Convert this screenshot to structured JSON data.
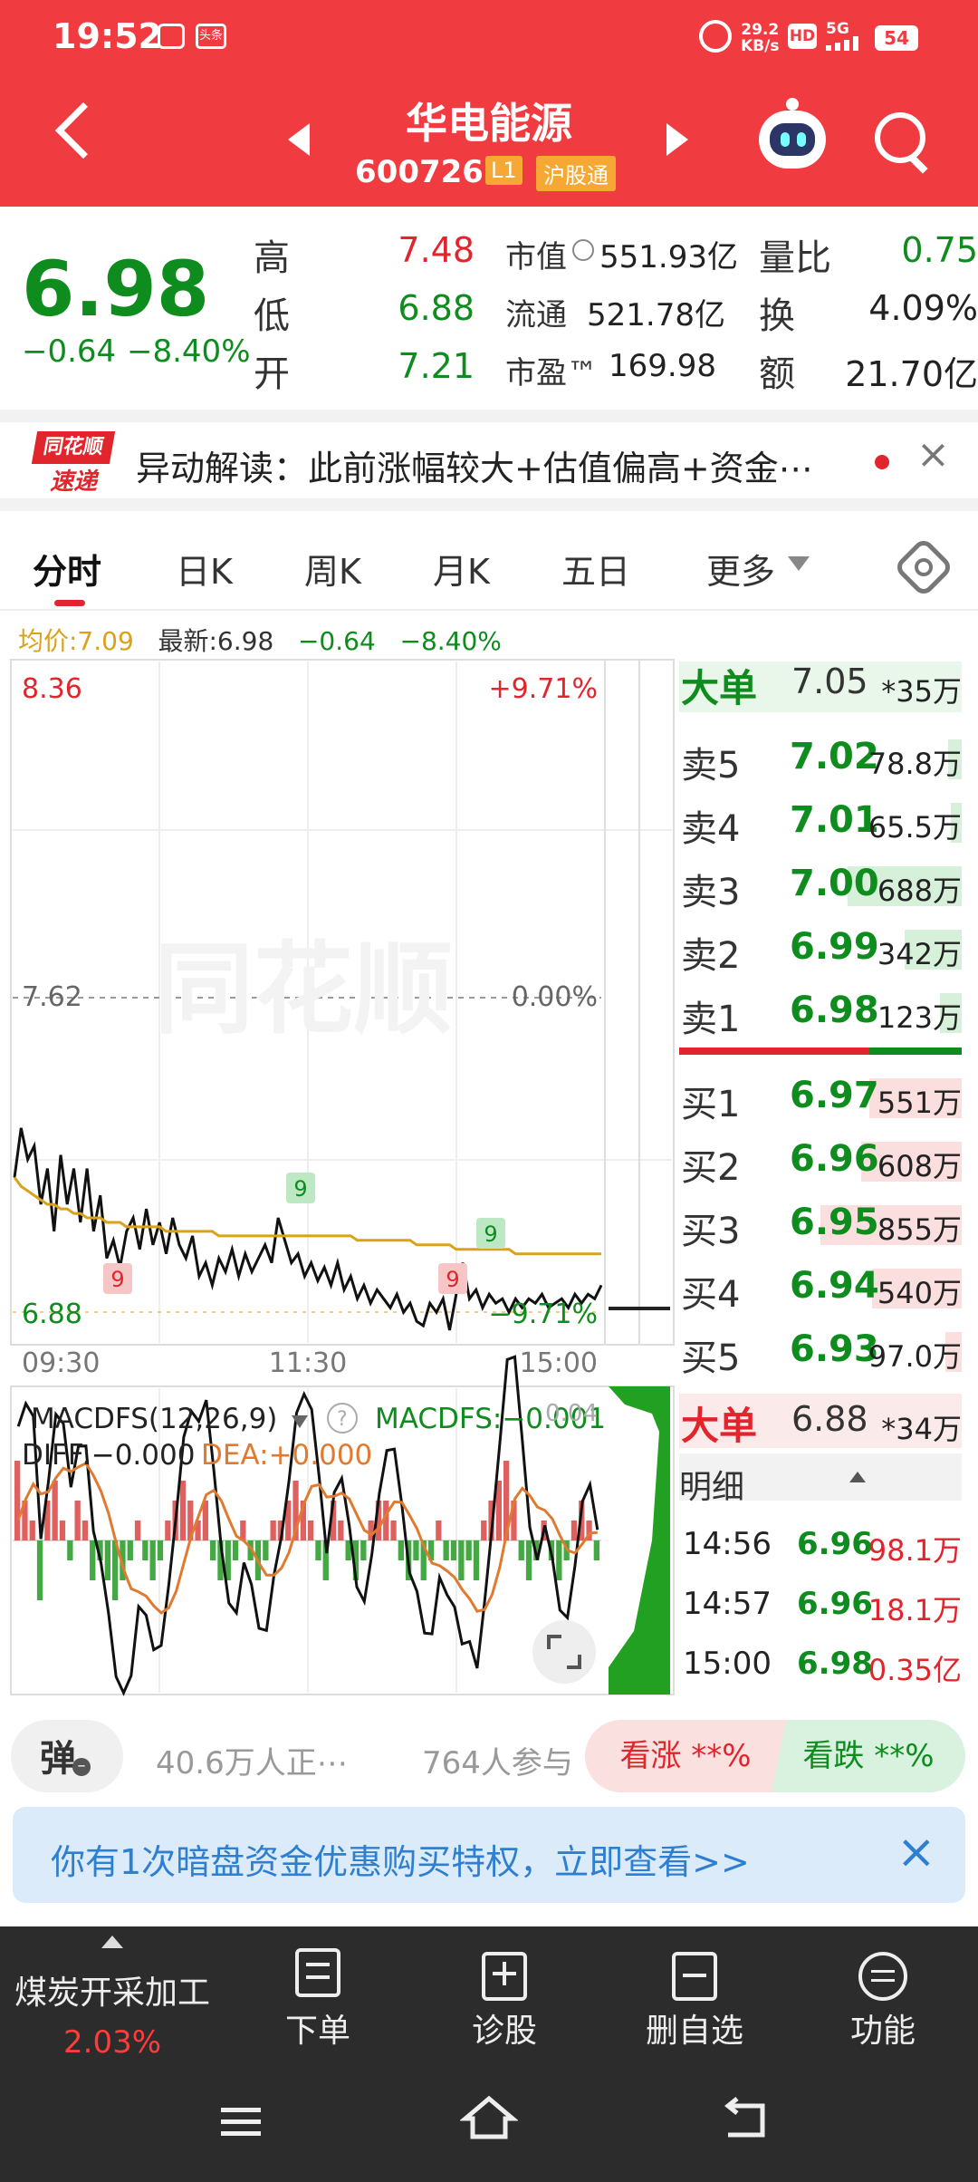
{
  "status": {
    "time": "19:52",
    "badge": "头条",
    "speed_value": "29.2",
    "speed_unit": "KB/s",
    "hd": "HD",
    "network": "5G",
    "battery": "54"
  },
  "header": {
    "name": "华电能源",
    "code": "600726",
    "tag_l1": "L1",
    "tag_hgt": "沪股通"
  },
  "quote": {
    "price": "6.98",
    "change": "−0.64",
    "change_pct": "−8.40%",
    "high_label": "高",
    "high": "7.48",
    "low_label": "低",
    "low": "6.88",
    "open_label": "开",
    "open": "7.21",
    "mcap_label": "市值",
    "mcap": "551.93亿",
    "float_label": "流通",
    "float": "521.78亿",
    "pe_label": "市盈™",
    "pe": "169.98",
    "vr_label": "量比",
    "vr": "0.75",
    "turn_label": "换",
    "turn": "4.09%",
    "amount_label": "额",
    "amount": "21.70亿"
  },
  "news": {
    "logo_top": "同花顺",
    "logo_bottom": "速递",
    "text": "异动解读：此前涨幅较大+估值偏高+资金⋯"
  },
  "tabs": [
    {
      "label": "分时"
    },
    {
      "label": "日K"
    },
    {
      "label": "周K"
    },
    {
      "label": "月K"
    },
    {
      "label": "五日"
    },
    {
      "label": "更多"
    }
  ],
  "chart_info": {
    "avg": "均价:7.09",
    "latest": "最新:6.98",
    "change": "−0.64",
    "pct": "−8.40%"
  },
  "chart_data": {
    "type": "line",
    "price_axis": {
      "top": "8.36",
      "mid": "7.62",
      "bottom": "6.88",
      "ylim": [
        6.88,
        8.36
      ],
      "prev_close": 7.62
    },
    "pct_axis": {
      "top": "+9.71%",
      "mid": "0.00%",
      "bottom": "−9.71%"
    },
    "time_labels": [
      "09:30",
      "11:30",
      "15:00"
    ],
    "watermark": "同花顺",
    "markers": [
      "9",
      "9",
      "9",
      "9"
    ],
    "series": [
      {
        "values": [
          7.22,
          7.33,
          7.26,
          7.29,
          7.16,
          7.24,
          7.1,
          7.27,
          7.16,
          7.24,
          7.12,
          7.24,
          7.1,
          7.18,
          7.04,
          7.08,
          7.02,
          7.1,
          7.13,
          7.06,
          7.15,
          7.07,
          7.12,
          7.05,
          7.13,
          7.07,
          7.04,
          7.09,
          7.0,
          7.03,
          6.98,
          7.04,
          7.01,
          7.06,
          7.0,
          7.05,
          7.01,
          7.04,
          7.07,
          7.03,
          7.13,
          7.08,
          7.03,
          7.05,
          7.0,
          7.03,
          6.99,
          7.02,
          6.98,
          7.03,
          6.97,
          7.0,
          6.95,
          6.98,
          6.94,
          6.97,
          6.95,
          6.93,
          6.96,
          6.92,
          6.94,
          6.9,
          6.89,
          6.94,
          6.92,
          6.95,
          6.88,
          6.96,
          7.03,
          6.95,
          6.97,
          6.93,
          6.96,
          6.94,
          6.95,
          6.92,
          6.95,
          6.93,
          6.95,
          6.94,
          6.96,
          6.93,
          6.94,
          6.95,
          6.93,
          6.96,
          6.94,
          6.96,
          6.95,
          6.98
        ]
      },
      {
        "values": [
          7.22,
          7.2,
          7.19,
          7.18,
          7.17,
          7.16,
          7.16,
          7.15,
          7.15,
          7.14,
          7.14,
          7.13,
          7.13,
          7.13,
          7.12,
          7.12,
          7.12,
          7.11,
          7.11,
          7.11,
          7.11,
          7.11,
          7.11,
          7.1,
          7.1,
          7.1,
          7.1,
          7.1,
          7.1,
          7.1,
          7.1,
          7.09,
          7.09,
          7.09,
          7.09,
          7.09,
          7.09,
          7.09,
          7.09,
          7.09,
          7.09,
          7.09,
          7.09,
          7.09,
          7.09,
          7.09,
          7.09,
          7.09,
          7.09,
          7.09,
          7.09,
          7.09,
          7.08,
          7.08,
          7.08,
          7.08,
          7.08,
          7.08,
          7.08,
          7.08,
          7.08,
          7.07,
          7.07,
          7.07,
          7.07,
          7.07,
          7.07,
          7.06,
          7.06,
          7.06,
          7.06,
          7.06,
          7.06,
          7.06,
          7.06,
          7.06,
          7.05,
          7.05,
          7.05,
          7.05,
          7.05,
          7.05,
          7.05,
          7.05,
          7.05,
          7.05,
          7.05,
          7.05,
          7.05,
          7.05
        ]
      }
    ]
  },
  "macd": {
    "title": "MACDFS(12,26,9)",
    "value_label": "MACDFS:−0.001",
    "diff": "DIFF:−0.000",
    "dea": "DEA:+0.000",
    "axis_top": "0.04",
    "hist": [
      0.04,
      0.02,
      0.01,
      -0.03,
      0.02,
      0.03,
      0.01,
      -0.01,
      0.02,
      0.01,
      -0.02,
      -0.01,
      -0.02,
      -0.03,
      -0.02,
      -0.01,
      0.01,
      -0.01,
      -0.02,
      -0.01,
      0.01,
      0.02,
      0.03,
      0.02,
      0.01,
      0.02,
      -0.01,
      -0.02,
      -0.02,
      -0.01,
      0.01,
      -0.01,
      -0.02,
      -0.01,
      0.01,
      0.01,
      0.02,
      0.03,
      0.02,
      0.01,
      -0.01,
      -0.02,
      0.02,
      0.01,
      -0.01,
      -0.02,
      -0.01,
      0.01,
      0.02,
      0.02,
      0.01,
      -0.01,
      -0.02,
      -0.01,
      -0.02,
      -0.01,
      0.01,
      -0.01,
      -0.01,
      -0.02,
      -0.01,
      -0.02,
      0.01,
      0.02,
      0.03,
      0.04,
      0.02,
      -0.01,
      -0.02,
      -0.01,
      0.01,
      -0.01,
      -0.02,
      -0.01,
      0.01,
      0.02,
      0.01,
      -0.01
    ]
  },
  "orderbook": {
    "big_sell": {
      "label": "大单",
      "price": "7.05",
      "vol": "*35万"
    },
    "sells": [
      {
        "label": "卖5",
        "price": "7.02",
        "vol": "78.8万",
        "depth": 0.05
      },
      {
        "label": "卖4",
        "price": "7.01",
        "vol": "65.5万",
        "depth": 0.04
      },
      {
        "label": "卖3",
        "price": "7.00",
        "vol": "688万",
        "depth": 0.42
      },
      {
        "label": "卖2",
        "price": "6.99",
        "vol": "342万",
        "depth": 0.21
      },
      {
        "label": "卖1",
        "price": "6.98",
        "vol": "123万",
        "depth": 0.08
      }
    ],
    "buys": [
      {
        "label": "买1",
        "price": "6.97",
        "vol": "551万",
        "depth": 0.34
      },
      {
        "label": "买2",
        "price": "6.96",
        "vol": "608万",
        "depth": 0.37
      },
      {
        "label": "买3",
        "price": "6.95",
        "vol": "855万",
        "depth": 0.52
      },
      {
        "label": "买4",
        "price": "6.94",
        "vol": "540万",
        "depth": 0.33
      },
      {
        "label": "买5",
        "price": "6.93",
        "vol": "97.0万",
        "depth": 0.06
      }
    ],
    "big_buy": {
      "label": "大单",
      "price": "6.88",
      "vol": "*34万"
    },
    "detail_title": "明细",
    "trades": [
      {
        "time": "14:56",
        "price": "6.96",
        "vol": "98.1万"
      },
      {
        "time": "14:57",
        "price": "6.96",
        "vol": "18.1万"
      },
      {
        "time": "15:00",
        "price": "6.98",
        "vol": "0.35亿"
      }
    ]
  },
  "sentiment": {
    "dan": "弹",
    "viewers": "40.6万人正⋯",
    "participants": "764人参与",
    "bull": "看涨 **%",
    "bear": "看跌 **%"
  },
  "promo": {
    "text": "你有1次暗盘资金优惠购买特权，立即查看>>"
  },
  "bottom": {
    "sector": "煤炭开采加工",
    "sector_pct": "2.03%",
    "items": [
      {
        "label": "下单"
      },
      {
        "label": "诊股"
      },
      {
        "label": "删自选"
      },
      {
        "label": "功能"
      }
    ]
  },
  "colors": {
    "header_red": "#f03c40",
    "up_red": "#e0262c",
    "down_green": "#0f8c1e",
    "avg_line": "#d9a21c"
  }
}
